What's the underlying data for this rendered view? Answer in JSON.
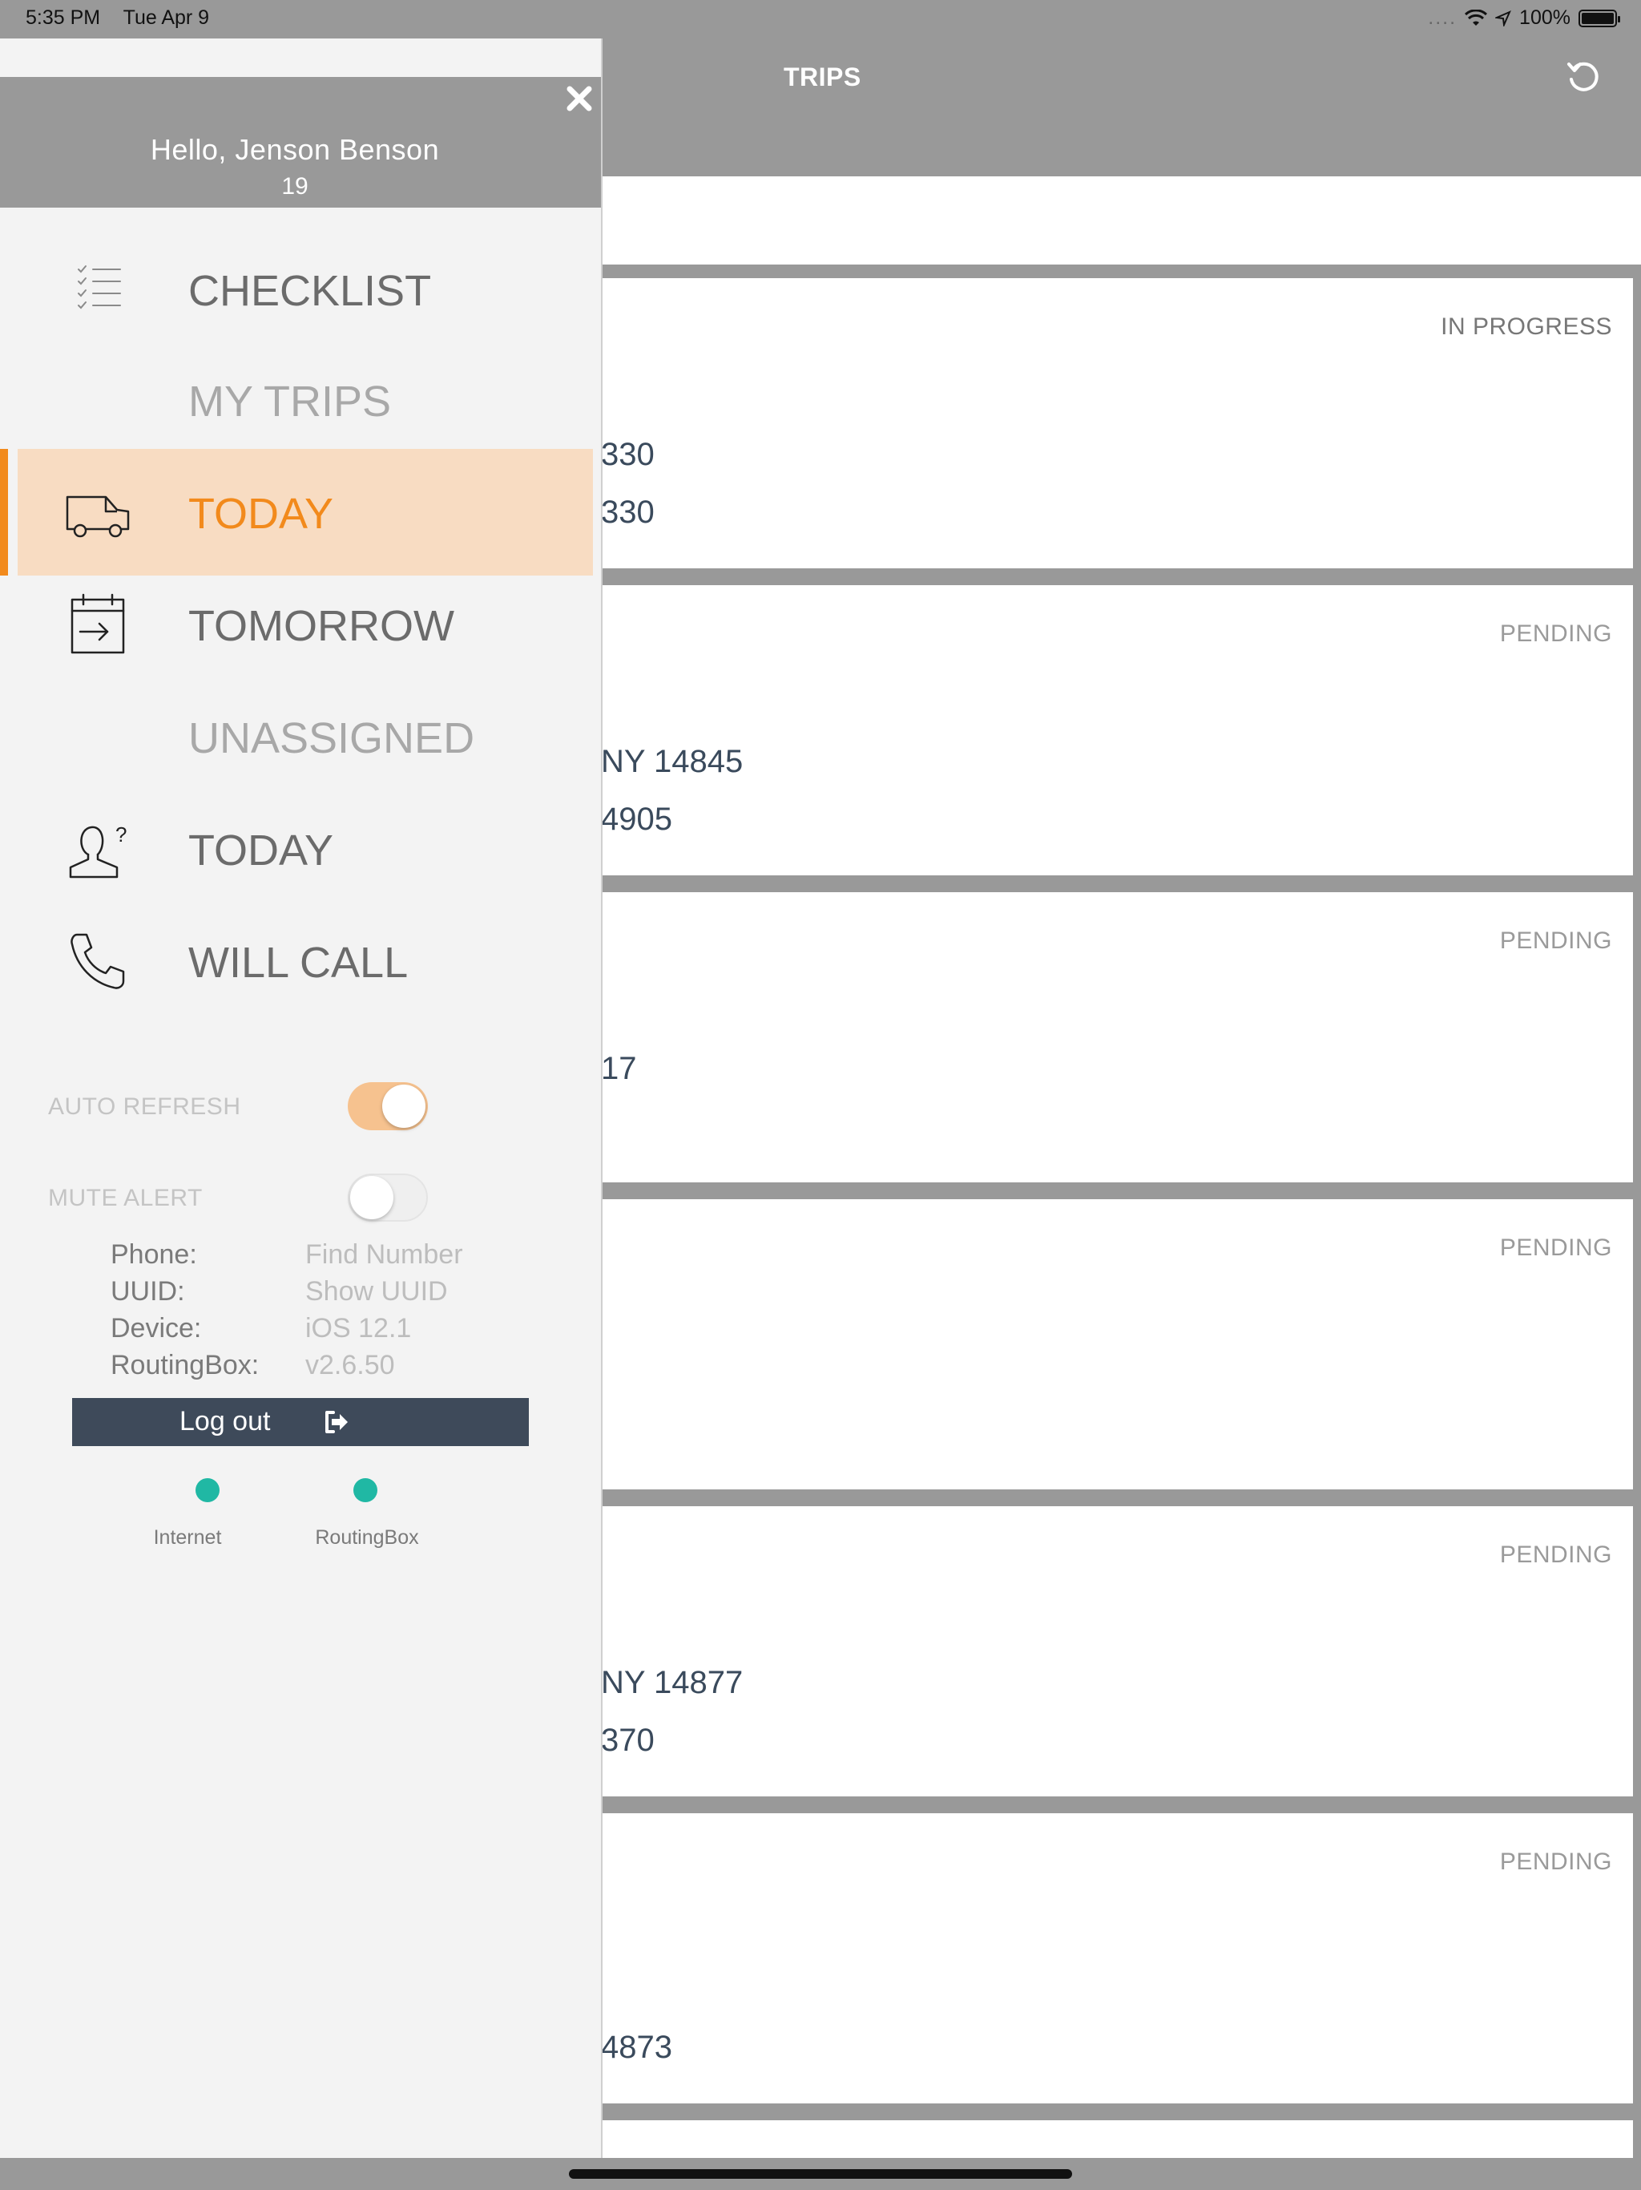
{
  "status_bar": {
    "time": "5:35 PM",
    "date": "Tue Apr 9",
    "signal": "....",
    "battery": "100%",
    "icons": [
      "wifi-icon",
      "location-icon",
      "battery-icon"
    ]
  },
  "header": {
    "title": "TRIPS",
    "refresh_icon": "refresh-icon"
  },
  "trips": [
    {
      "status": "IN PROGRESS",
      "line1": "330",
      "line2": "330"
    },
    {
      "status": "PENDING",
      "line1": "NY 14845",
      "line2": "4905"
    },
    {
      "status": "PENDING",
      "line1": "17",
      "line2": ""
    },
    {
      "status": "PENDING",
      "line1": "",
      "line2": ""
    },
    {
      "status": "PENDING",
      "line1": "NY 14877",
      "line2": "370"
    },
    {
      "status": "PENDING",
      "line1": "",
      "line2": "4873"
    }
  ],
  "drawer": {
    "greeting": "Hello, Jenson Benson",
    "driver_id": "19",
    "close_icon": "close-icon",
    "menu": {
      "checklist": "CHECKLIST",
      "my_trips_section": "MY TRIPS",
      "today": "TODAY",
      "tomorrow": "TOMORROW",
      "unassigned_section": "UNASSIGNED",
      "unassigned_today": "TODAY",
      "will_call": "WILL CALL"
    },
    "settings": {
      "auto_refresh_label": "AUTO REFRESH",
      "auto_refresh_on": true,
      "mute_alert_label": "MUTE ALERT",
      "mute_alert_on": false
    },
    "info": {
      "phone_label": "Phone:",
      "phone_value": "Find Number",
      "uuid_label": "UUID:",
      "uuid_value": "Show UUID",
      "device_label": "Device:",
      "device_value": "iOS 12.1",
      "routingbox_label": "RoutingBox:",
      "routingbox_value": "v2.6.50"
    },
    "logout_label": "Log out",
    "connection": {
      "internet_label": "Internet",
      "routingbox_label": "RoutingBox",
      "status_color": "#20b8a4"
    }
  },
  "colors": {
    "accent": "#f28a1c",
    "active_bg": "#f8dcc2",
    "logout_bg": "#3e4a5a",
    "overlay_gray": "#999999"
  }
}
